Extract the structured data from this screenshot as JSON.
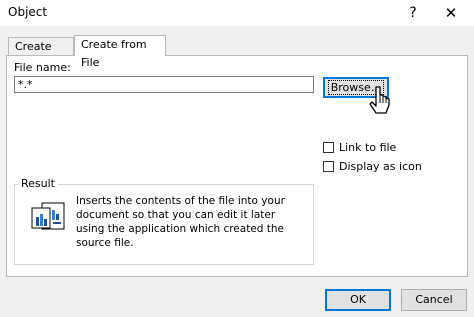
{
  "window": {
    "title": "Object",
    "help_label": "?",
    "close_label": "✕"
  },
  "tabs": [
    {
      "label": "Create New",
      "active": false
    },
    {
      "label": "Create from File",
      "active": true
    }
  ],
  "file_name": {
    "label": "File name:",
    "value": "*.*"
  },
  "browse_label": "Browse...",
  "options": {
    "link_label": "Link to file",
    "icon_label": "Display as icon",
    "link_checked": false,
    "icon_checked": false
  },
  "result": {
    "title": "Result",
    "text": "Inserts the contents of the file into your document so that you can edit it later using the application which created the source file."
  },
  "buttons": {
    "ok": "OK",
    "cancel": "Cancel"
  },
  "colors": {
    "focus": "#0078d7",
    "panel": "#ffffff",
    "dialog": "#f0f0f0"
  }
}
